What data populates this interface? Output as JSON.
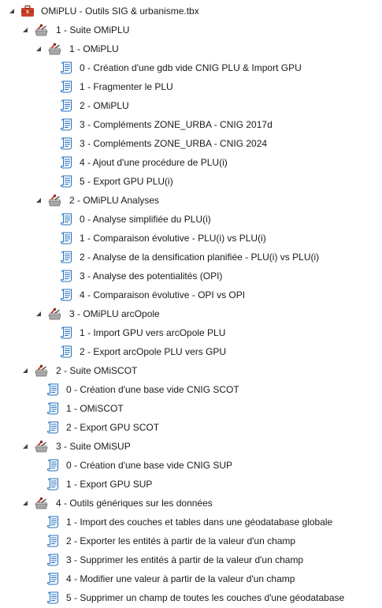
{
  "accent": "#1f6fbf",
  "toolbox": {
    "label": "OMiPLU - Outils SIG & urbanisme.tbx",
    "icon": "toolbox-icon"
  },
  "rows": [
    {
      "level": 1,
      "type": "toolset",
      "expanded": true,
      "label": "1 - Suite OMiPLU"
    },
    {
      "level": 2,
      "type": "toolset",
      "expanded": true,
      "label": "1 - OMiPLU"
    },
    {
      "level": 3,
      "type": "script",
      "label": "0 - Création d'une gdb vide CNIG PLU & Import GPU"
    },
    {
      "level": 3,
      "type": "script",
      "label": "1 - Fragmenter le PLU"
    },
    {
      "level": 3,
      "type": "script",
      "label": "2 - OMiPLU"
    },
    {
      "level": 3,
      "type": "script",
      "label": "3 - Compléments ZONE_URBA - CNIG 2017d"
    },
    {
      "level": 3,
      "type": "script",
      "label": "3 - Compléments ZONE_URBA - CNIG 2024"
    },
    {
      "level": 3,
      "type": "script",
      "label": "4 - Ajout d'une procédure de PLU(i)"
    },
    {
      "level": 3,
      "type": "script",
      "label": "5 - Export GPU PLU(i)"
    },
    {
      "level": 2,
      "type": "toolset",
      "expanded": true,
      "label": "2 - OMiPLU Analyses"
    },
    {
      "level": 3,
      "type": "script",
      "label": "0 - Analyse simplifiée du PLU(i)"
    },
    {
      "level": 3,
      "type": "script",
      "label": "1 - Comparaison évolutive - PLU(i) vs PLU(i)"
    },
    {
      "level": 3,
      "type": "script",
      "label": "2 - Analyse de la densification planifiée - PLU(i) vs PLU(i)"
    },
    {
      "level": 3,
      "type": "script",
      "label": "3 - Analyse des potentialités (OPI)"
    },
    {
      "level": 3,
      "type": "script",
      "label": "4 - Comparaison évolutive - OPI vs OPI"
    },
    {
      "level": 2,
      "type": "toolset",
      "expanded": true,
      "label": "3 - OMiPLU arcOpole"
    },
    {
      "level": 3,
      "type": "script",
      "label": "1 - Import GPU vers arcOpole PLU"
    },
    {
      "level": 3,
      "type": "script",
      "label": "2 - Export arcOpole PLU vers GPU"
    },
    {
      "level": 1,
      "type": "toolset",
      "expanded": true,
      "label": "2 - Suite OMiSCOT"
    },
    {
      "level": 2,
      "type": "script",
      "label": "0 - Création d'une base vide CNIG SCOT"
    },
    {
      "level": 2,
      "type": "script",
      "label": "1 - OMiSCOT"
    },
    {
      "level": 2,
      "type": "script",
      "label": "2 - Export GPU SCOT"
    },
    {
      "level": 1,
      "type": "toolset",
      "expanded": true,
      "label": "3 - Suite OMiSUP"
    },
    {
      "level": 2,
      "type": "script",
      "label": "0 - Création d'une base vide CNIG SUP"
    },
    {
      "level": 2,
      "type": "script",
      "label": "1 - Export GPU SUP"
    },
    {
      "level": 1,
      "type": "toolset",
      "expanded": true,
      "label": "4 - Outils génériques sur les données"
    },
    {
      "level": 2,
      "type": "script",
      "label": "1 - Import des couches et tables dans une géodatabase globale"
    },
    {
      "level": 2,
      "type": "script",
      "label": "2 - Exporter les entités à partir de la valeur d'un champ"
    },
    {
      "level": 2,
      "type": "script",
      "label": "3 - Supprimer les entités à partir de la valeur d'un champ"
    },
    {
      "level": 2,
      "type": "script",
      "label": "4 - Modifier une valeur à partir de la valeur d'un champ"
    },
    {
      "level": 2,
      "type": "script",
      "label": "5 - Supprimer un champ de toutes les couches d'une géodatabase"
    }
  ]
}
